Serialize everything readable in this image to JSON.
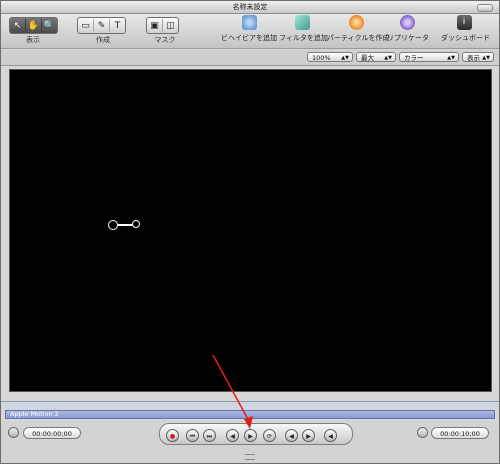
{
  "window": {
    "title": "名称未設定"
  },
  "toolbar": {
    "groups": [
      {
        "label": "表示",
        "icons": [
          "arrow-cursor-icon",
          "hand-icon",
          "magnifier-icon"
        ]
      },
      {
        "label": "作成",
        "icons": [
          "rectangle-icon",
          "bezier-pen-icon",
          "text-t-icon"
        ]
      },
      {
        "label": "マスク",
        "icons": [
          "rect-mask-icon",
          "bezier-mask-icon"
        ]
      }
    ],
    "glyphs": {
      "arrow": "↖",
      "hand": "✋",
      "magnifier": "🔍",
      "rect": "▭",
      "pen": "✎",
      "text": "T",
      "rectmask": "▣",
      "beziermask": "◫"
    },
    "buttons": {
      "behavior": "ビヘイビアを追加",
      "filter": "フィルタを追加",
      "particle": "パーティクルを作成",
      "replicator": "リプリケータ",
      "dashboard": "ダッシュボード"
    },
    "colors": {
      "behavior": "#6aa0d8",
      "filter": "#3d9f8a",
      "particle": "#e9852a",
      "replicator": "#7f5cc8",
      "dashboard": "#3c3c3c"
    }
  },
  "options": {
    "zoom": "100%",
    "resolution": "最大",
    "channels": "カラー",
    "view": "表示"
  },
  "timeline": {
    "project_name": "Apple Motion 2"
  },
  "transport": {
    "start_timecode": "00:00:00;00",
    "end_timecode": "00:00:10;00",
    "buttons": [
      {
        "name": "record-button",
        "glyph": "●",
        "rec": true
      },
      {
        "name": "go-to-start-button",
        "glyph": "⏮"
      },
      {
        "name": "go-to-end-button",
        "glyph": "⏭"
      },
      {
        "name": "step-back-button",
        "glyph": "◀"
      },
      {
        "name": "play-button",
        "glyph": "▶"
      },
      {
        "name": "loop-button",
        "glyph": "⟳"
      },
      {
        "name": "audio-button",
        "glyph": "◀"
      },
      {
        "name": "step-forward-button",
        "glyph": "▶"
      },
      {
        "name": "mute-button",
        "glyph": "◀"
      }
    ]
  },
  "annotation": {
    "arrow_color": "#e0201b"
  }
}
